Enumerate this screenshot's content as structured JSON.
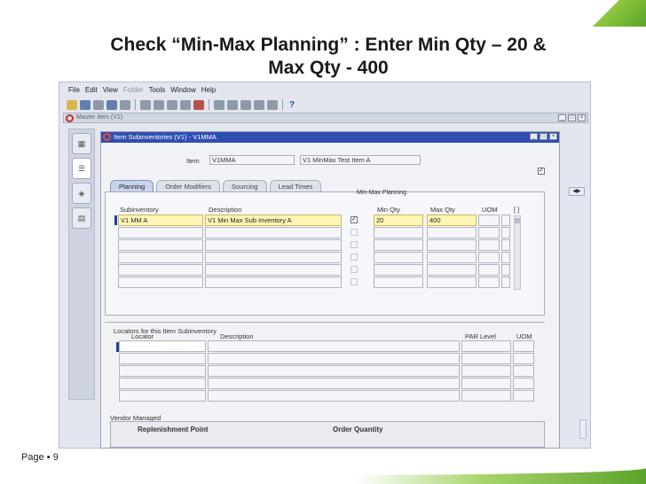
{
  "slide": {
    "title_line1": "Check “Min-Max Planning” : Enter Min Qty – 20 &",
    "title_line2": "Max Qty - 400",
    "page_label": "Page ▪ 9"
  },
  "menu": [
    "File",
    "Edit",
    "View",
    "Folder",
    "Tools",
    "Window",
    "Help"
  ],
  "toolbar": {
    "help_label": "?"
  },
  "outer_window": {
    "title": "Master Item (V1)"
  },
  "inner_window": {
    "title": "Item Subinventories (V1) - V1MMA"
  },
  "item": {
    "label": "Item",
    "value": "V1MMA",
    "description": "V1 MinMax Test Item A"
  },
  "tabs": [
    "Planning",
    "Order Modifiers",
    "Sourcing",
    "Lead Times"
  ],
  "planning": {
    "group_heading": "Min-Max Planning",
    "columns": {
      "subinventory": "Subinventory",
      "description": "Description",
      "min_qty": "Min Qty",
      "max_qty": "Max Qty",
      "uom": "UOM",
      "bracket": "[ ]"
    },
    "rows": [
      {
        "subinventory": "V1 MM A",
        "description": "V1 Min Max Sub Inventory A",
        "min_max": "✓",
        "min_qty": "20",
        "max_qty": "400",
        "uom": ""
      },
      {
        "subinventory": "",
        "description": "",
        "min_max": "",
        "min_qty": "",
        "max_qty": "",
        "uom": ""
      },
      {
        "subinventory": "",
        "description": "",
        "min_max": "",
        "min_qty": "",
        "max_qty": "",
        "uom": ""
      },
      {
        "subinventory": "",
        "description": "",
        "min_max": "",
        "min_qty": "",
        "max_qty": "",
        "uom": ""
      },
      {
        "subinventory": "",
        "description": "",
        "min_max": "",
        "min_qty": "",
        "max_qty": "",
        "uom": ""
      },
      {
        "subinventory": "",
        "description": "",
        "min_max": "",
        "min_qty": "",
        "max_qty": "",
        "uom": ""
      }
    ]
  },
  "locators": {
    "section_title": "Locators for this Item Subinventory",
    "columns": {
      "locator": "Locator",
      "description": "Description",
      "par_level": "PAR Level",
      "uom": "UOM"
    }
  },
  "vendor": {
    "section_title": "Vendor Managed",
    "replenishment_point": "Replenishment Point",
    "order_quantity": "Order Quantity"
  },
  "colors": {
    "title_bar": "#2f4fb0",
    "required_field": "#fff6b5",
    "accent_green": "#5ba42a"
  }
}
